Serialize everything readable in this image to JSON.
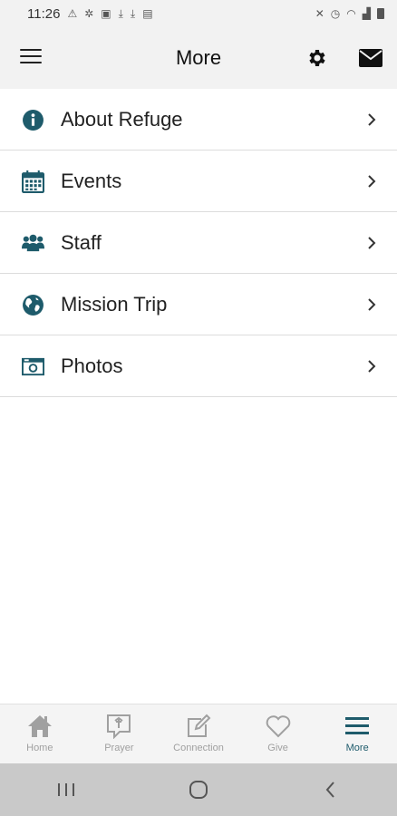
{
  "status_bar": {
    "time": "11:26"
  },
  "header": {
    "title": "More"
  },
  "menu": {
    "items": [
      {
        "label": "About Refuge",
        "icon": "info-icon"
      },
      {
        "label": "Events",
        "icon": "calendar-icon"
      },
      {
        "label": "Staff",
        "icon": "users-icon"
      },
      {
        "label": "Mission Trip",
        "icon": "globe-icon"
      },
      {
        "label": "Photos",
        "icon": "camera-icon"
      }
    ]
  },
  "tab_bar": {
    "tabs": [
      {
        "label": "Home",
        "icon": "home-icon"
      },
      {
        "label": "Prayer",
        "icon": "prayer-icon"
      },
      {
        "label": "Connection",
        "icon": "edit-icon"
      },
      {
        "label": "Give",
        "icon": "heart-icon"
      },
      {
        "label": "More",
        "icon": "menu-icon",
        "active": true
      }
    ]
  },
  "colors": {
    "accent": "#1e5b6b",
    "inactive_tab": "#a0a0a0",
    "header_bg": "#f2f2f2"
  }
}
